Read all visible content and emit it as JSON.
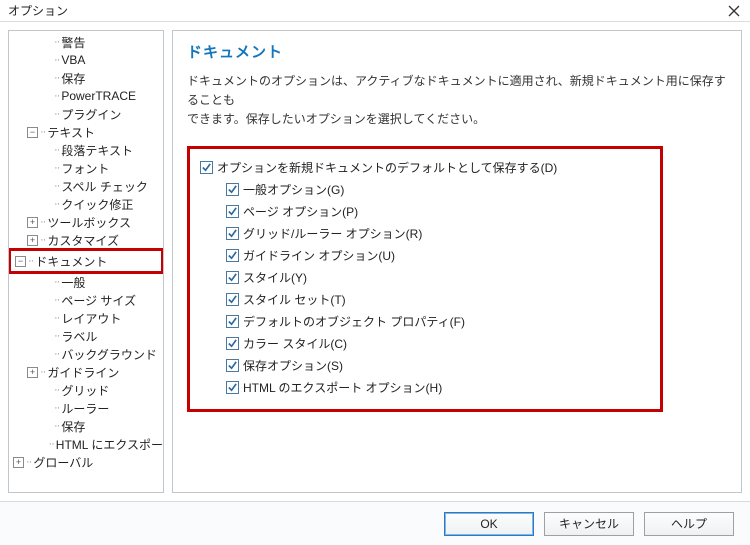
{
  "window": {
    "title": "オプション"
  },
  "tree": [
    {
      "label": "警告",
      "indent": 3,
      "exp": null
    },
    {
      "label": "VBA",
      "indent": 3,
      "exp": null
    },
    {
      "label": "保存",
      "indent": 3,
      "exp": null
    },
    {
      "label": "PowerTRACE",
      "indent": 3,
      "exp": null
    },
    {
      "label": "プラグイン",
      "indent": 3,
      "exp": null
    },
    {
      "label": "テキスト",
      "indent": 2,
      "exp": "-"
    },
    {
      "label": "段落テキスト",
      "indent": 3,
      "exp": null
    },
    {
      "label": "フォント",
      "indent": 3,
      "exp": null
    },
    {
      "label": "スペル チェック",
      "indent": 3,
      "exp": null
    },
    {
      "label": "クイック修正",
      "indent": 3,
      "exp": null
    },
    {
      "label": "ツールボックス",
      "indent": 2,
      "exp": "+"
    },
    {
      "label": "カスタマイズ",
      "indent": 2,
      "exp": "+"
    },
    {
      "label": "ドキュメント",
      "indent": 1,
      "exp": "-",
      "hi": true
    },
    {
      "label": "一般",
      "indent": 3,
      "exp": null
    },
    {
      "label": "ページ サイズ",
      "indent": 3,
      "exp": null
    },
    {
      "label": "レイアウト",
      "indent": 3,
      "exp": null
    },
    {
      "label": "ラベル",
      "indent": 3,
      "exp": null
    },
    {
      "label": "バックグラウンド",
      "indent": 3,
      "exp": null
    },
    {
      "label": "ガイドライン",
      "indent": 2,
      "exp": "+"
    },
    {
      "label": "グリッド",
      "indent": 3,
      "exp": null
    },
    {
      "label": "ルーラー",
      "indent": 3,
      "exp": null
    },
    {
      "label": "保存",
      "indent": 3,
      "exp": null
    },
    {
      "label": "HTML にエクスポー",
      "indent": 3,
      "exp": null
    },
    {
      "label": "グローバル",
      "indent": 1,
      "exp": "+"
    }
  ],
  "panel": {
    "heading": "ドキュメント",
    "desc_l1": "ドキュメントのオプションは、アクティブなドキュメントに適用され、新規ドキュメント用に保存することも",
    "desc_l2": "できます。保存したいオプションを選択してください。",
    "main_opt": {
      "label": "オプションを新規ドキュメントのデフォルトとして保存する(D)",
      "checked": true
    },
    "opts": [
      {
        "label": "一般オプション(G)",
        "checked": true
      },
      {
        "label": "ページ オプション(P)",
        "checked": true
      },
      {
        "label": "グリッド/ルーラー オプション(R)",
        "checked": true
      },
      {
        "label": "ガイドライン オプション(U)",
        "checked": true
      },
      {
        "label": "スタイル(Y)",
        "checked": true
      },
      {
        "label": "スタイル セット(T)",
        "checked": true
      },
      {
        "label": "デフォルトのオブジェクト プロパティ(F)",
        "checked": true
      },
      {
        "label": "カラー スタイル(C)",
        "checked": true
      },
      {
        "label": "保存オプション(S)",
        "checked": true
      },
      {
        "label": "HTML のエクスポート オプション(H)",
        "checked": true
      }
    ]
  },
  "buttons": {
    "ok": "OK",
    "cancel": "キャンセル",
    "help": "ヘルプ"
  }
}
